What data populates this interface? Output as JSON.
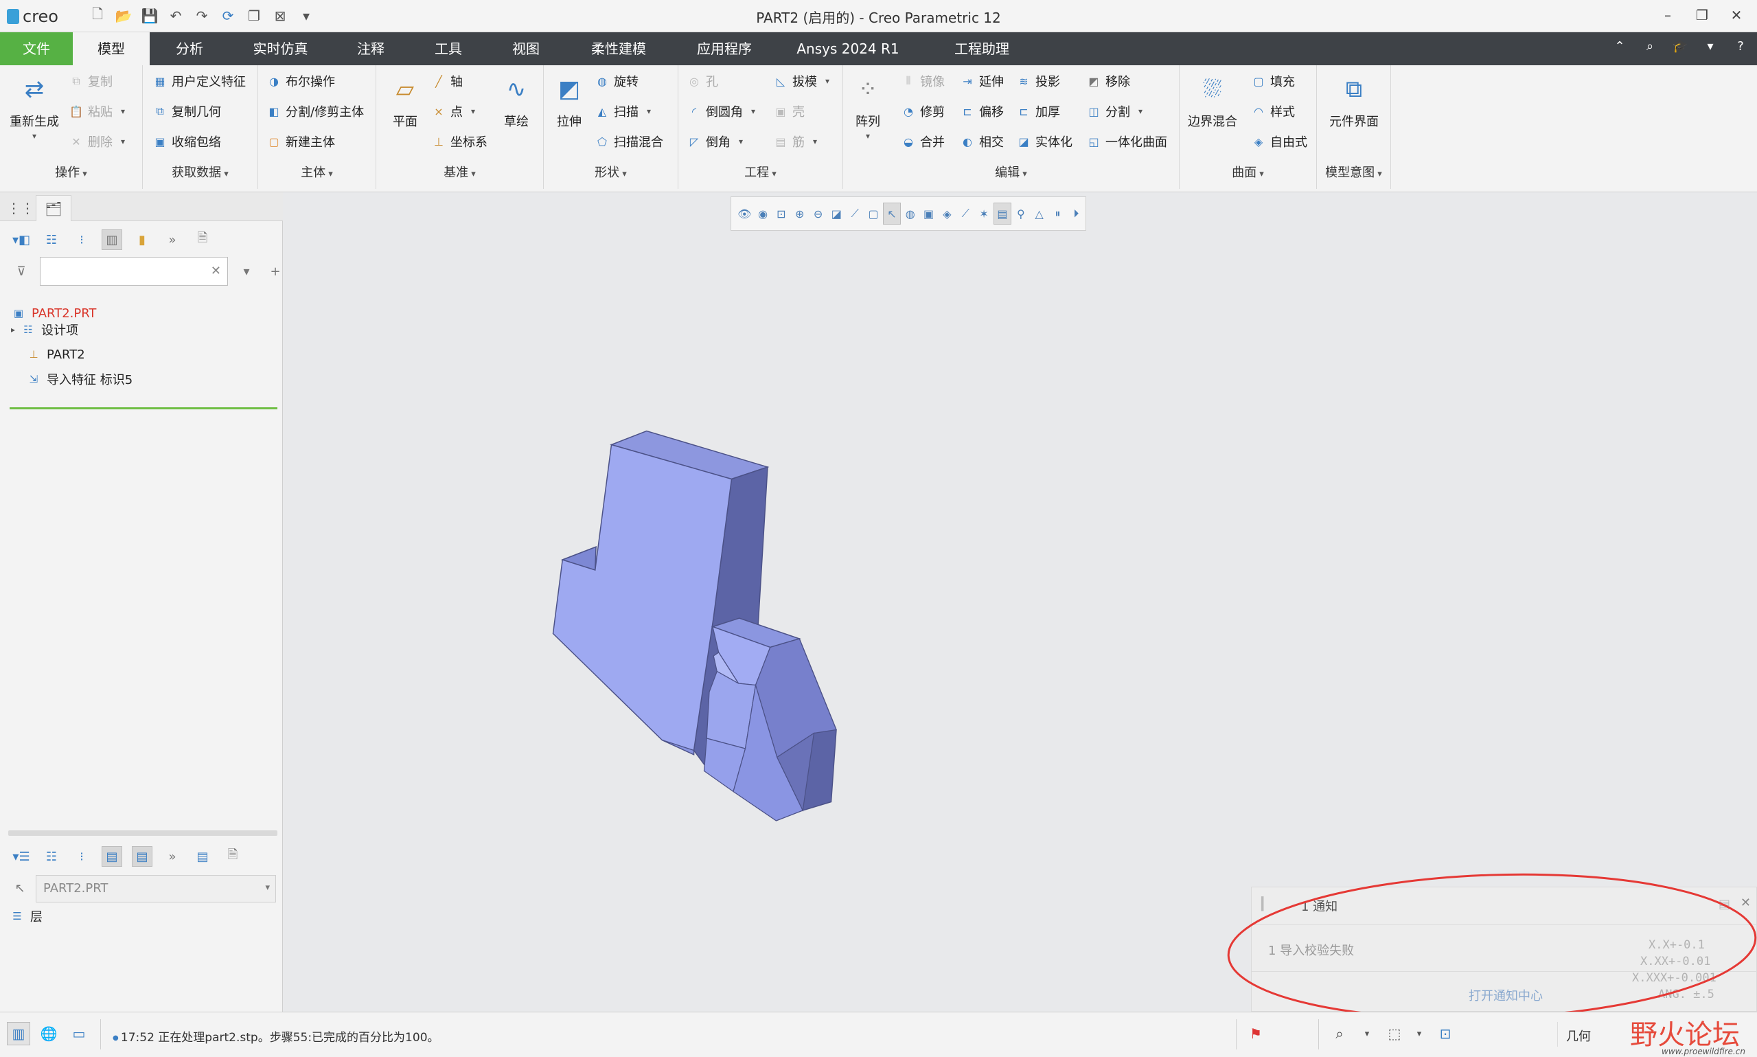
{
  "window": {
    "title": "PART2 (启用的) - Creo Parametric 12",
    "logo_text": "creo",
    "qat_icons": [
      "new-icon",
      "open-icon",
      "save-icon",
      "undo-icon",
      "redo-icon",
      "regenerate-icon",
      "switch-window-icon",
      "close-window-icon",
      "customize-icon"
    ]
  },
  "tabs": [
    "文件",
    "模型",
    "分析",
    "实时仿真",
    "注释",
    "工具",
    "视图",
    "柔性建模",
    "应用程序",
    "Ansys 2024 R1",
    "工程助理"
  ],
  "active_tab": "模型",
  "ribbon": {
    "operations": {
      "label": "操作",
      "regenerate": "重新生成",
      "copy": "复制",
      "paste": "粘贴",
      "delete": "删除"
    },
    "get_data": {
      "label": "获取数据",
      "udf": "用户定义特征",
      "copy_geom": "复制几何",
      "shrinkwrap": "收缩包络"
    },
    "body": {
      "label": "主体",
      "boolean": "布尔操作",
      "split_trim": "分割/修剪主体",
      "new_body": "新建主体"
    },
    "datum": {
      "label": "基准",
      "plane": "平面",
      "axis": "轴",
      "point": "点",
      "csys": "坐标系",
      "sketch": "草绘"
    },
    "shapes": {
      "label": "形状",
      "extrude": "拉伸",
      "revolve": "旋转",
      "sweep": "扫描",
      "swept_blend": "扫描混合"
    },
    "engineering": {
      "label": "工程",
      "hole": "孔",
      "round": "倒圆角",
      "chamfer": "倒角",
      "draft": "拔模",
      "shell": "壳",
      "rib": "筋"
    },
    "editing": {
      "label": "编辑",
      "pattern": "阵列",
      "mirror": "镜像",
      "trim": "修剪",
      "merge": "合并",
      "extend": "延伸",
      "offset": "偏移",
      "intersect": "相交",
      "project": "投影",
      "thicken": "加厚",
      "solidify": "实体化",
      "remove": "移除",
      "split": "分割",
      "unify": "一体化曲面"
    },
    "surfaces": {
      "label": "曲面",
      "boundary_blend": "边界混合",
      "fill": "填充",
      "style": "样式",
      "freestyle": "自由式"
    },
    "model_intent": {
      "label": "模型意图",
      "component_interface": "元件界面"
    }
  },
  "model_tree": {
    "search_placeholder": "",
    "root": "PART2.PRT",
    "items": [
      "设计项",
      "PART2",
      "导入特征 标识5"
    ]
  },
  "layer_tree": {
    "selected_model": "PART2.PRT",
    "item": "层"
  },
  "notification": {
    "title": "1 通知",
    "message": "1 导入校验失败",
    "link": "打开通知中心",
    "tolerances": [
      "X.X+-0.1",
      "X.XX+-0.01",
      "X.XXX+-0.001",
      "ANG. ±.5"
    ]
  },
  "statusbar": {
    "message": "17:52 正在处理part2.stp。步骤55:已完成的百分比为100。",
    "filter": "几何"
  },
  "watermark": {
    "text": "野火论坛",
    "url": "www.proewildfire.cn"
  },
  "colors": {
    "file_tab": "#56b144",
    "tab_bar": "#3e4247",
    "model_face_light": "#9aa6ee",
    "model_face_mid": "#7f8bd6",
    "model_face_dark": "#5d65a8",
    "annotation": "#e53935"
  }
}
